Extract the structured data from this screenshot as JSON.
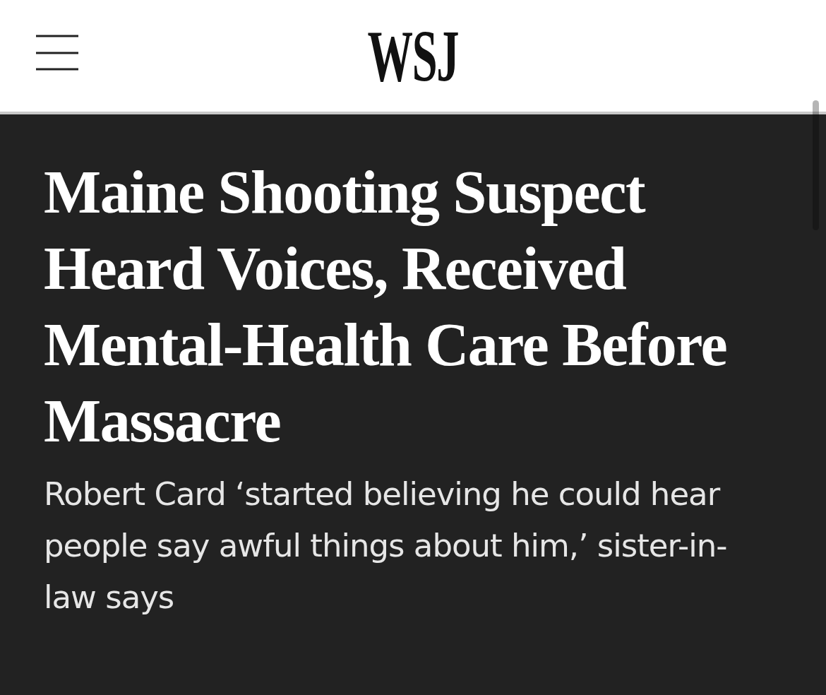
{
  "header": {
    "logo": "WSJ"
  },
  "article": {
    "headline": "Maine Shooting Suspect Heard Voices, Received Mental-Health Care Before Massacre",
    "dek": "Robert Card ‘started believing he could hear people say awful things about him,’ sister-in-law says"
  }
}
